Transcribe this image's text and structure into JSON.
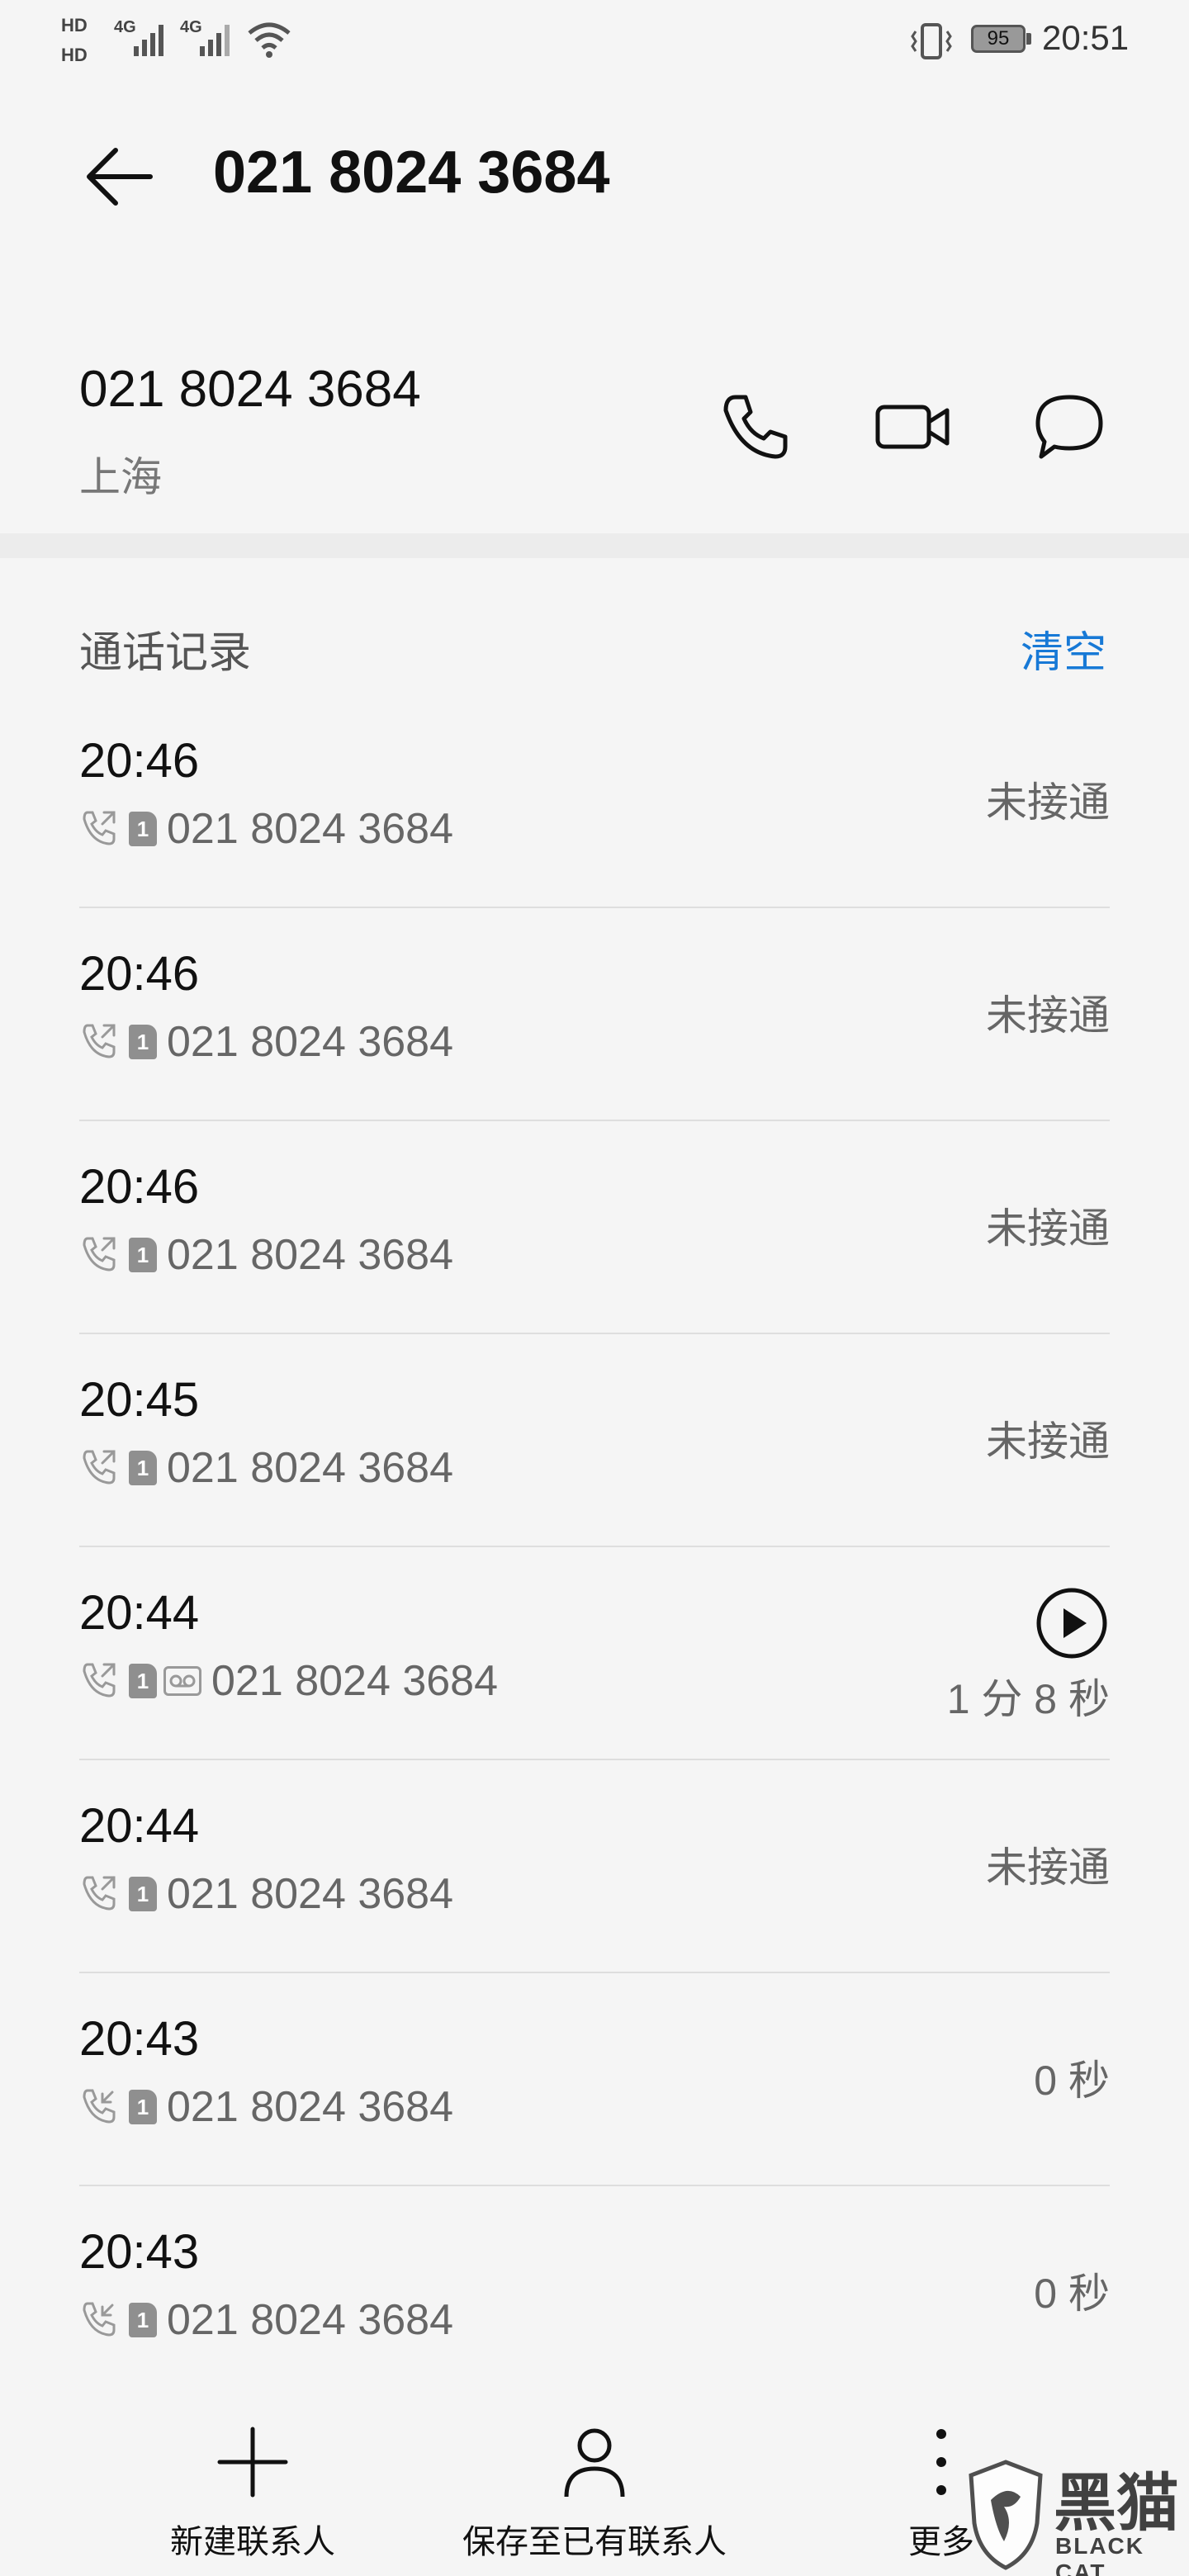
{
  "status_bar": {
    "hd1": "HD",
    "hd2": "HD",
    "net1": "4G",
    "net2": "4G",
    "battery": "95",
    "time": "20:51"
  },
  "header": {
    "title": "021 8024 3684"
  },
  "contact": {
    "number": "021 8024 3684",
    "location": "上海"
  },
  "calls": {
    "section_title": "通话记录",
    "clear_label": "清空",
    "items": [
      {
        "time": "20:46",
        "number": "021 8024 3684",
        "sim": "1",
        "status": "未接通",
        "type": "outgoing",
        "voicemail": false
      },
      {
        "time": "20:46",
        "number": "021 8024 3684",
        "sim": "1",
        "status": "未接通",
        "type": "outgoing",
        "voicemail": false
      },
      {
        "time": "20:46",
        "number": "021 8024 3684",
        "sim": "1",
        "status": "未接通",
        "type": "outgoing",
        "voicemail": false
      },
      {
        "time": "20:45",
        "number": "021 8024 3684",
        "sim": "1",
        "status": "未接通",
        "type": "outgoing",
        "voicemail": false
      },
      {
        "time": "20:44",
        "number": "021 8024 3684",
        "sim": "1",
        "status": "1 分 8 秒",
        "type": "outgoing",
        "voicemail": true
      },
      {
        "time": "20:44",
        "number": "021 8024 3684",
        "sim": "1",
        "status": "未接通",
        "type": "outgoing",
        "voicemail": false
      },
      {
        "time": "20:43",
        "number": "021 8024 3684",
        "sim": "1",
        "status": "0 秒",
        "type": "incoming",
        "voicemail": false
      },
      {
        "time": "20:43",
        "number": "021 8024 3684",
        "sim": "1",
        "status": "0 秒",
        "type": "incoming",
        "voicemail": false
      }
    ]
  },
  "bottom_bar": {
    "new_contact": "新建联系人",
    "save_existing": "保存至已有联系人",
    "more": "更多"
  },
  "watermark": {
    "text": "黑猫",
    "sub": "BLACK CAT"
  },
  "colors": {
    "accent": "#1779d6",
    "background": "#f5f5f5"
  }
}
